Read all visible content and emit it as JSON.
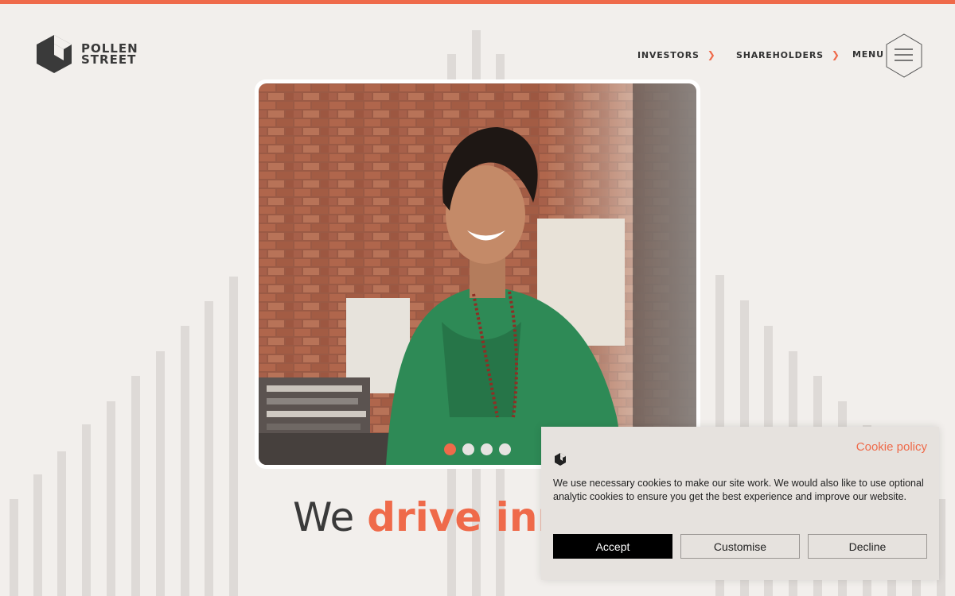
{
  "brand": {
    "name_line1": "POLLEN",
    "name_line2": "STREET",
    "accent_color": "#ef6a4a"
  },
  "nav": {
    "investors": "INVESTORS",
    "shareholders": "SHAREHOLDERS",
    "arrow": "❯",
    "menu_label": "MENU"
  },
  "hero": {
    "slides_total": 4,
    "active_slide": 1
  },
  "headline": {
    "lead": "We",
    "accent": "drive inno"
  },
  "cookie": {
    "policy_link": "Cookie policy",
    "text": "We use necessary cookies to make our site work. We would also like to use optional analytic cookies to ensure you get the best experience and improve our website.",
    "accept": "Accept",
    "customise": "Customise",
    "decline": "Decline"
  }
}
